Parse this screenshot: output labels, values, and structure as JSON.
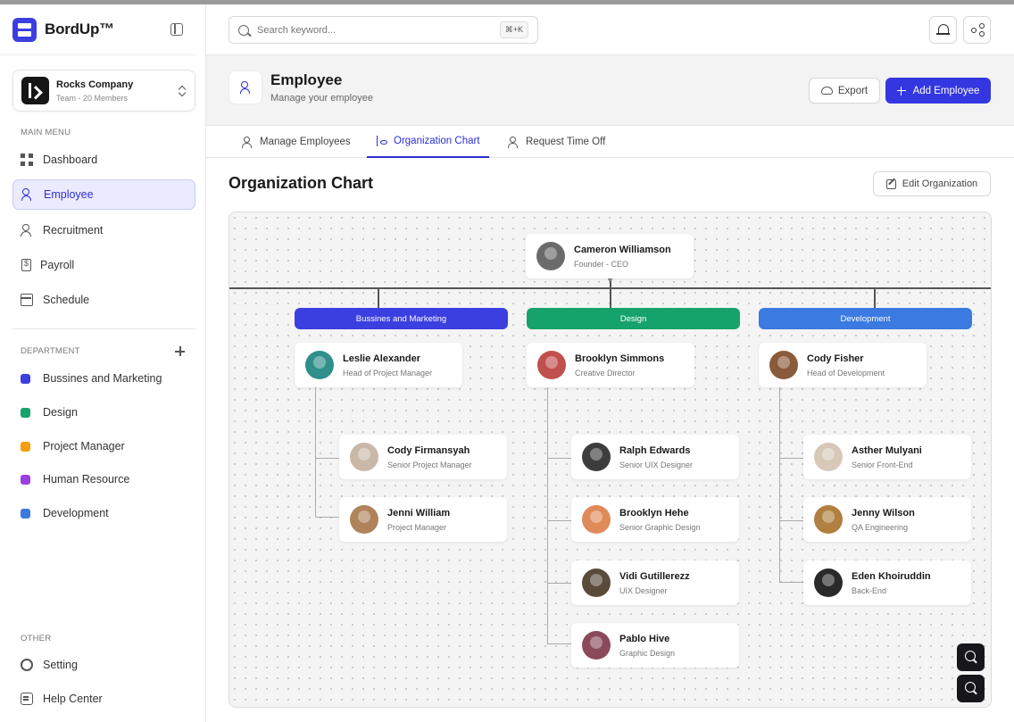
{
  "app": {
    "name": "BordUp™"
  },
  "company": {
    "name": "Rocks Company",
    "subtitle": "Team - 20 Members"
  },
  "sidebar": {
    "main_menu_label": "MAIN MENU",
    "items": [
      {
        "label": "Dashboard",
        "icon": "grid-icon"
      },
      {
        "label": "Employee",
        "icon": "users-icon",
        "active": true
      },
      {
        "label": "Recruitment",
        "icon": "user-plus-icon"
      },
      {
        "label": "Payroll",
        "icon": "invoice-icon"
      },
      {
        "label": "Schedule",
        "icon": "calendar-icon"
      }
    ],
    "department_label": "DEPARTMENT",
    "departments": [
      {
        "label": "Bussines and Marketing",
        "color": "#3b3fe0"
      },
      {
        "label": "Design",
        "color": "#16a36b"
      },
      {
        "label": "Project Manager",
        "color": "#f59e0b"
      },
      {
        "label": "Human Resource",
        "color": "#9b3fe0"
      },
      {
        "label": "Development",
        "color": "#3b7ae0"
      }
    ],
    "other_label": "OTHER",
    "other": [
      {
        "label": "Setting",
        "icon": "gear-icon"
      },
      {
        "label": "Help Center",
        "icon": "help-icon"
      }
    ]
  },
  "search": {
    "placeholder": "Search keyword...",
    "shortcut": "⌘+K"
  },
  "header": {
    "title": "Employee",
    "subtitle": "Manage your employee",
    "export_label": "Export",
    "add_label": "Add Employee"
  },
  "tabs": [
    {
      "label": "Manage Employees"
    },
    {
      "label": "Organization Chart",
      "active": true
    },
    {
      "label": "Request Time Off"
    }
  ],
  "org": {
    "title": "Organization Chart",
    "edit_label": "Edit Organization",
    "root": {
      "name": "Cameron Williamson",
      "role": "Founder - CEO",
      "avatar_color": "#6b6b6b"
    },
    "departments": [
      {
        "name": "Bussines and Marketing",
        "color": "#3b3fe0",
        "head": {
          "name": "Leslie Alexander",
          "role": "Head of Project Manager",
          "avatar_color": "#2f8f8a"
        },
        "members": [
          {
            "name": "Cody Firmansyah",
            "role": "Senior Project Manager",
            "avatar_color": "#c9b8a8"
          },
          {
            "name": "Jenni William",
            "role": "Project Manager",
            "avatar_color": "#b0835a"
          }
        ]
      },
      {
        "name": "Design",
        "color": "#16a36b",
        "head": {
          "name": "Brooklyn Simmons",
          "role": "Creative Director",
          "avatar_color": "#c0504d"
        },
        "members": [
          {
            "name": "Ralph Edwards",
            "role": "Senior UIX Designer",
            "avatar_color": "#3d3d3d"
          },
          {
            "name": "Brooklyn Hehe",
            "role": "Senior Graphic Design",
            "avatar_color": "#e08a5a"
          },
          {
            "name": "Vidi Gutillerezz",
            "role": "UIX Designer",
            "avatar_color": "#5a4a3a"
          },
          {
            "name": "Pablo Hive",
            "role": "Graphic Design",
            "avatar_color": "#8a4a5a"
          }
        ]
      },
      {
        "name": "Development",
        "color": "#3b7ae0",
        "head": {
          "name": "Cody Fisher",
          "role": "Head of Development",
          "avatar_color": "#8a5a3a"
        },
        "members": [
          {
            "name": "Asther Mulyani",
            "role": "Senior Front-End",
            "avatar_color": "#d8c8b8"
          },
          {
            "name": "Jenny Wilson",
            "role": "QA Engineering",
            "avatar_color": "#b08040"
          },
          {
            "name": "Eden Khoiruddin",
            "role": "Back-End",
            "avatar_color": "#2a2a2a"
          }
        ]
      }
    ]
  }
}
